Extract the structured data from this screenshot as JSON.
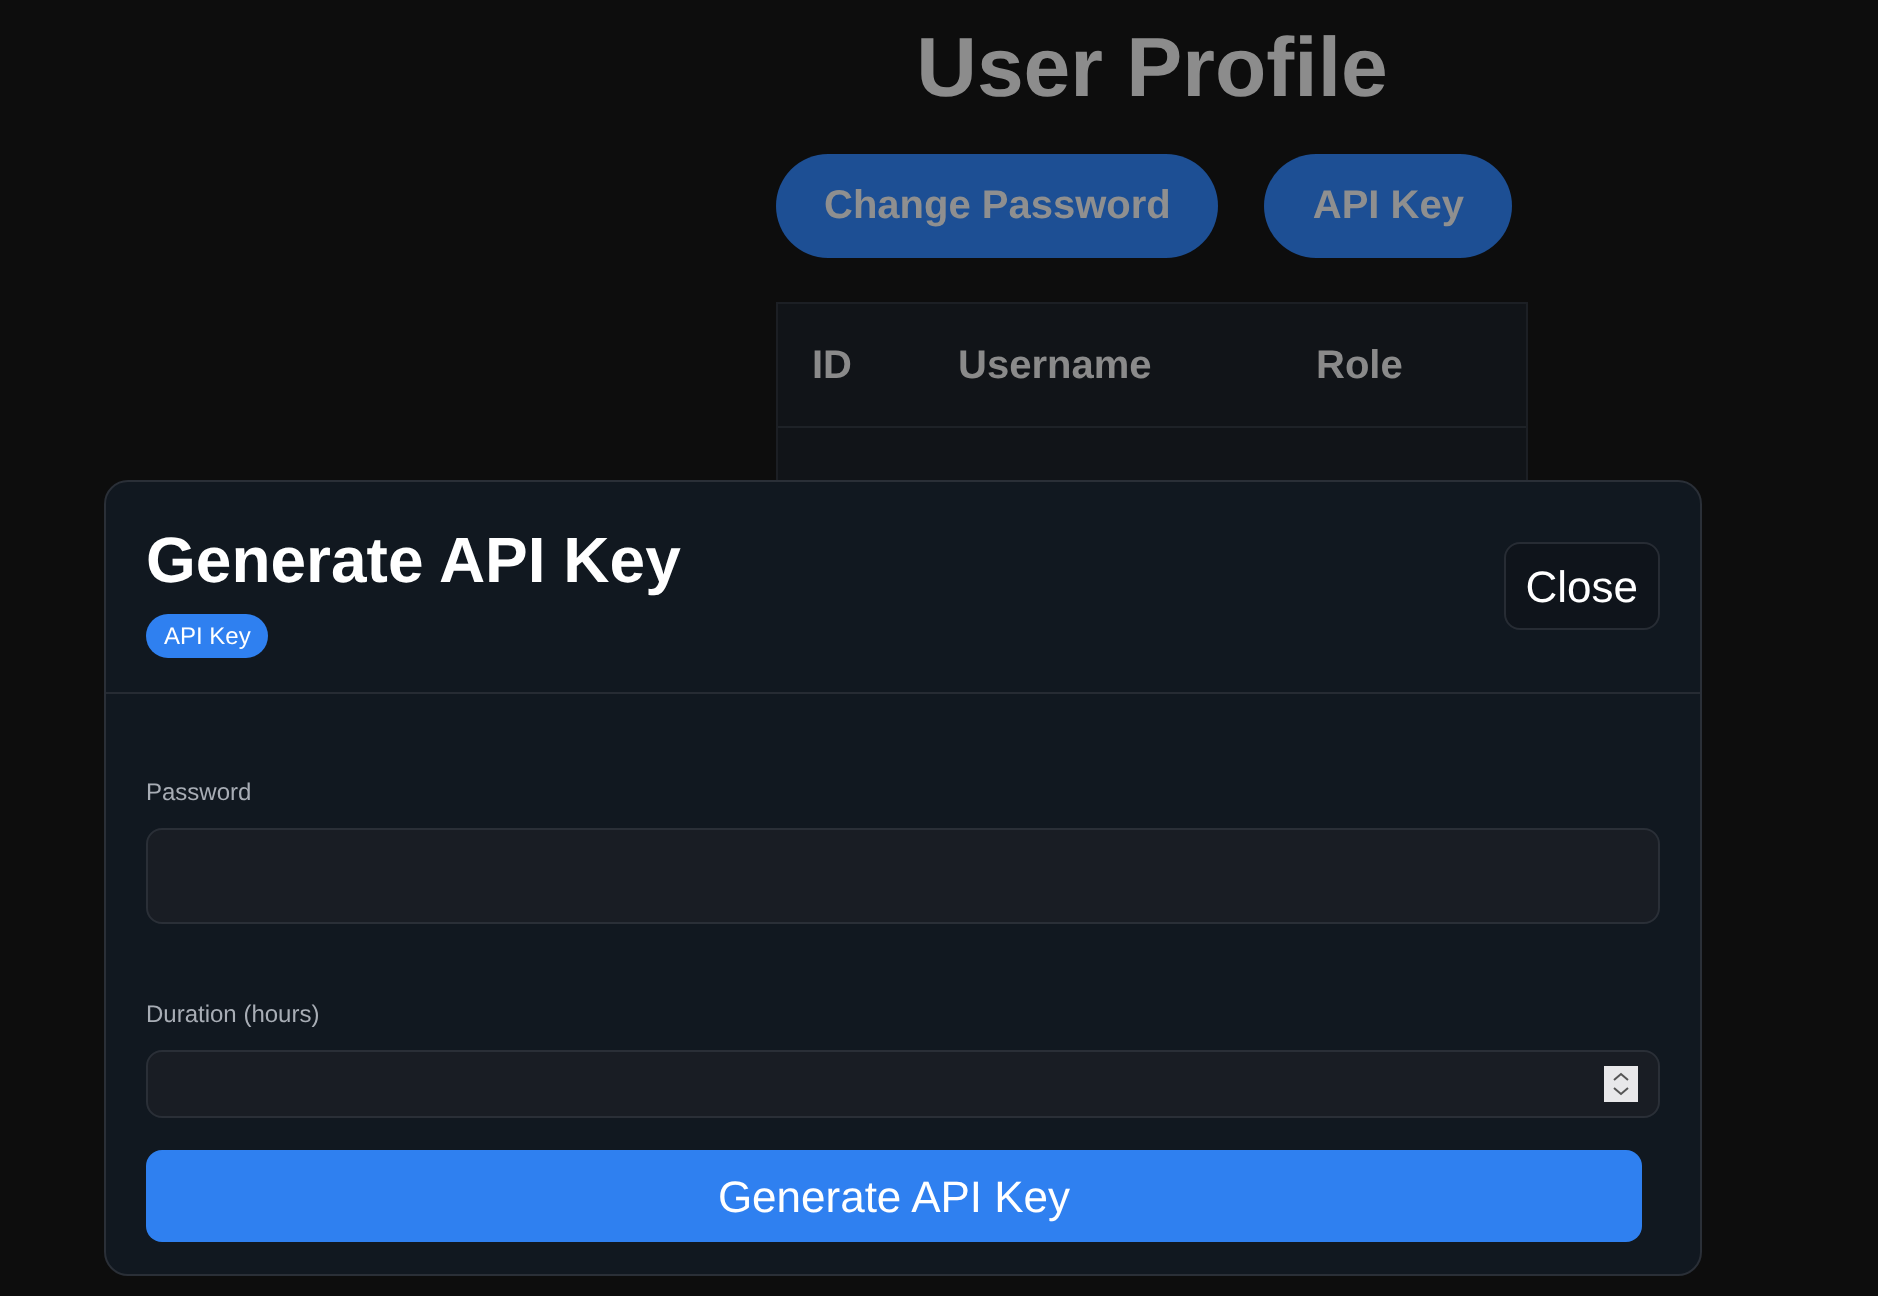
{
  "page": {
    "title": "User Profile",
    "buttons": [
      "Change Password",
      "API Key"
    ]
  },
  "table": {
    "columns": [
      "ID",
      "Username",
      "Role"
    ]
  },
  "modal": {
    "title": "Generate API Key",
    "badge": "API Key",
    "close": "Close",
    "fields": [
      {
        "label": "Password",
        "kind": "password"
      },
      {
        "label": "Duration (hours)",
        "kind": "number"
      }
    ],
    "submit": "Generate API Key"
  }
}
